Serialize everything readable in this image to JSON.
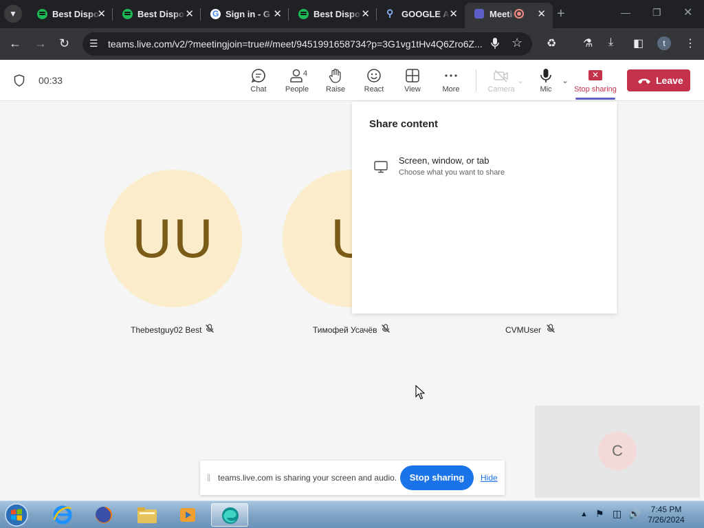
{
  "browser": {
    "tabs": [
      {
        "title": "Best Dispo",
        "icon": "spotify-icon"
      },
      {
        "title": "Best Dispo",
        "icon": "spotify-icon"
      },
      {
        "title": "Sign in - G",
        "icon": "google-icon"
      },
      {
        "title": "Best Dispo",
        "icon": "spotify-icon"
      },
      {
        "title": "GOOGLE A",
        "icon": "search-icon"
      },
      {
        "title": "Meetin",
        "icon": "teams-icon",
        "active": true,
        "recording": true
      }
    ],
    "url": "teams.live.com/v2/?meetingjoin=true#/meet/9451991658734?p=3G1vg1tHv4Q6Zro6Z...",
    "profile_initial": "t"
  },
  "meeting": {
    "elapsed": "00:33",
    "people_count": "4",
    "toolbar": {
      "chat": "Chat",
      "people": "People",
      "raise": "Raise",
      "react": "React",
      "view": "View",
      "more": "More",
      "camera": "Camera",
      "mic": "Mic",
      "stop_sharing": "Stop sharing",
      "leave": "Leave"
    },
    "participants": [
      {
        "initials": "UU",
        "name": "Thebestguy02 Best",
        "muted": true
      },
      {
        "initials": "U",
        "name": "Тимофей Усачёв",
        "muted": true
      },
      {
        "initials": "",
        "name": "CVMUser",
        "muted": true
      }
    ],
    "self_initial": "C"
  },
  "share_panel": {
    "title": "Share content",
    "option_title": "Screen, window, or tab",
    "option_subtitle": "Choose what you want to share"
  },
  "share_bar": {
    "message": "teams.live.com is sharing your screen and audio.",
    "stop_label": "Stop sharing",
    "hide_label": "Hide"
  },
  "taskbar": {
    "time": "7:45 PM",
    "date": "7/26/2024"
  },
  "colors": {
    "leave_red": "#c4314b",
    "teams_purple": "#5b5fc7",
    "avatar_bg": "#fbeccb",
    "chrome_blue": "#1a73e8"
  }
}
